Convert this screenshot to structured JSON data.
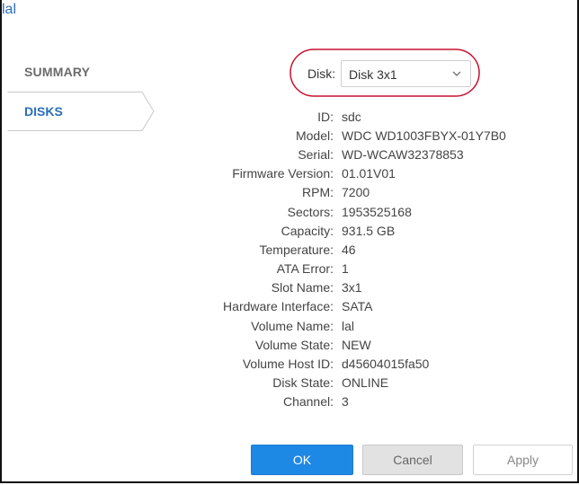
{
  "window": {
    "title": "lal"
  },
  "nav": {
    "summary_label": "SUMMARY",
    "disks_label": "DISKS"
  },
  "disk_selector": {
    "label": "Disk:",
    "selected": "Disk 3x1"
  },
  "details": [
    {
      "key": "ID:",
      "value": "sdc"
    },
    {
      "key": "Model:",
      "value": "WDC WD1003FBYX-01Y7B0"
    },
    {
      "key": "Serial:",
      "value": "WD-WCAW32378853"
    },
    {
      "key": "Firmware Version:",
      "value": "01.01V01"
    },
    {
      "key": "RPM:",
      "value": "7200"
    },
    {
      "key": "Sectors:",
      "value": "1953525168"
    },
    {
      "key": "Capacity:",
      "value": "931.5 GB"
    },
    {
      "key": "Temperature:",
      "value": "46"
    },
    {
      "key": "ATA Error:",
      "value": "1"
    },
    {
      "key": "Slot Name:",
      "value": "3x1"
    },
    {
      "key": "Hardware Interface:",
      "value": "SATA"
    },
    {
      "key": "Volume Name:",
      "value": "lal"
    },
    {
      "key": "Volume State:",
      "value": "NEW"
    },
    {
      "key": "Volume Host ID:",
      "value": "d45604015fa50"
    },
    {
      "key": "Disk State:",
      "value": "ONLINE"
    },
    {
      "key": "Channel:",
      "value": "3"
    }
  ],
  "buttons": {
    "ok": "OK",
    "cancel": "Cancel",
    "apply": "Apply"
  },
  "colors": {
    "accent": "#1e88e5",
    "link": "#2a6ebb",
    "highlight_ring": "#c8102e"
  }
}
